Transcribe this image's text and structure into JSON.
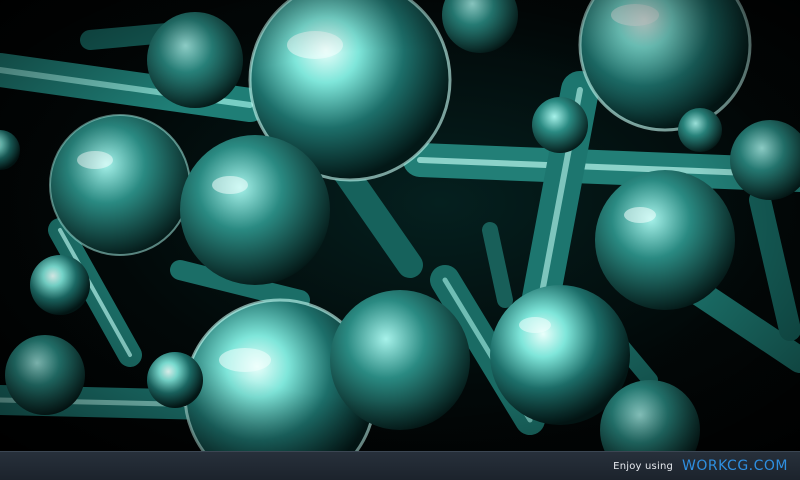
{
  "footer": {
    "credit_prefix": "Enjoy using",
    "brand": "WORKCG.COM"
  },
  "colors": {
    "brand": "#2e8fe0",
    "footer_bg": "#1f262f",
    "glass_tint": "#3fd2c4"
  }
}
